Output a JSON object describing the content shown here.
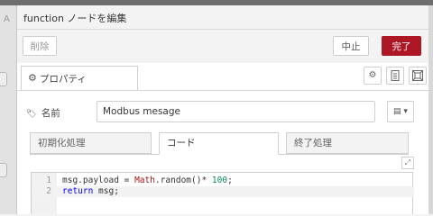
{
  "canvas": {
    "tab_letter": "A"
  },
  "tray": {
    "title": "function ノードを編集",
    "toolbar": {
      "delete_label": "削除",
      "cancel_label": "中止",
      "done_label": "完了"
    },
    "properties_tab": {
      "label": "プロパティ"
    }
  },
  "form": {
    "name_label": "名前",
    "name_value": "Modbus mesage",
    "icon_select_label": "▾"
  },
  "code_tabs": [
    "初期化処理",
    "コード",
    "終了処理"
  ],
  "editor": {
    "lines": [
      {
        "number": "1",
        "tokens": [
          "msg.payload = ",
          "Math",
          ".random()",
          "* ",
          "100",
          ";"
        ]
      },
      {
        "number": "2",
        "tokens": [
          "return",
          " msg;"
        ]
      }
    ]
  }
}
